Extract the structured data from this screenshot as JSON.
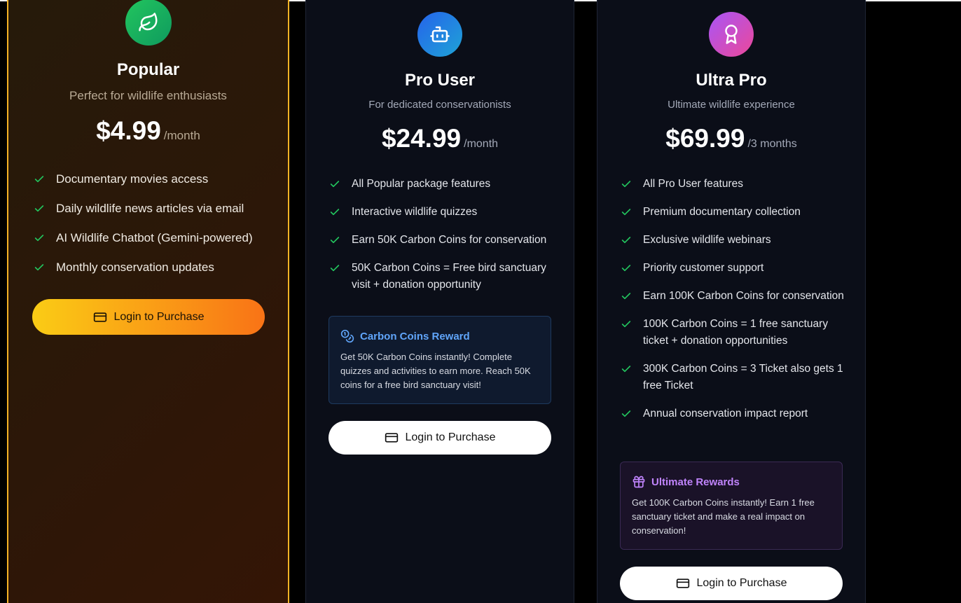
{
  "plans": [
    {
      "name": "Popular",
      "subtitle": "Perfect for wildlife enthusiasts",
      "price": "$4.99",
      "period": "/month",
      "icon": "leaf-icon",
      "features": [
        "Documentary movies access",
        "Daily wildlife news articles via email",
        "AI Wildlife Chatbot (Gemini-powered)",
        "Monthly conservation updates"
      ],
      "button_label": "Login to Purchase"
    },
    {
      "name": "Pro User",
      "subtitle": "For dedicated conservationists",
      "price": "$24.99",
      "period": "/month",
      "icon": "bot-icon",
      "features": [
        "All Popular package features",
        "Interactive wildlife quizzes",
        "Earn 50K Carbon Coins for conservation",
        "50K Carbon Coins = Free bird sanctuary visit + donation opportunity"
      ],
      "reward": {
        "title": "Carbon Coins Reward",
        "icon": "coins-icon",
        "text": "Get 50K Carbon Coins instantly! Complete quizzes and activities to earn more. Reach 50K coins for a free bird sanctuary visit!"
      },
      "button_label": "Login to Purchase"
    },
    {
      "name": "Ultra Pro",
      "subtitle": "Ultimate wildlife experience",
      "price": "$69.99",
      "period": "/3 months",
      "icon": "award-icon",
      "features": [
        "All Pro User features",
        "Premium documentary collection",
        "Exclusive wildlife webinars",
        "Priority customer support",
        "Earn 100K Carbon Coins for conservation",
        "100K Carbon Coins = 1 free sanctuary ticket + donation opportunities",
        "300K Carbon Coins = 3 Ticket also gets 1 free Ticket",
        "Annual conservation impact report"
      ],
      "reward": {
        "title": "Ultimate Rewards",
        "icon": "gift-icon",
        "text": "Get 100K Carbon Coins instantly! Earn 1 free sanctuary ticket and make a real impact on conservation!"
      },
      "button_label": "Login to Purchase"
    }
  ],
  "colors": {
    "popular_border": "#f5b325",
    "check": "#22c55e",
    "popular_button_start": "#facc15",
    "popular_button_end": "#f97316",
    "pro_reward_accent": "#60a5fa",
    "ultra_reward_accent": "#c084fc"
  }
}
